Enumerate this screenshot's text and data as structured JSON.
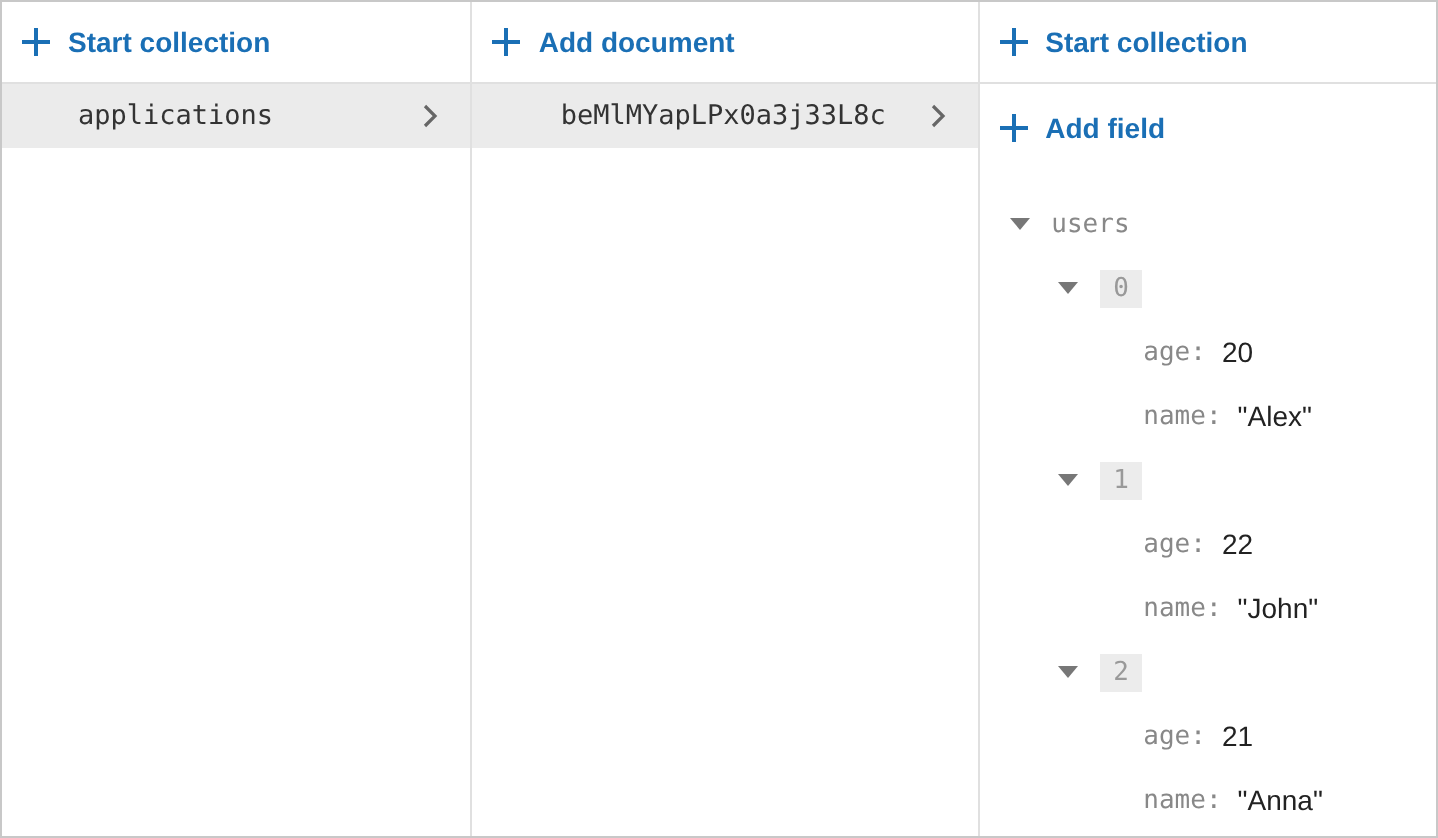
{
  "collections_panel": {
    "action": {
      "label": "Start collection"
    },
    "items": [
      {
        "label": "applications",
        "selected": true
      }
    ]
  },
  "documents_panel": {
    "action": {
      "label": "Add document"
    },
    "items": [
      {
        "label": "beMlMYapLPx0a3j33L8c",
        "selected": true
      }
    ]
  },
  "document_panel": {
    "actions": [
      {
        "label": "Start collection"
      },
      {
        "label": "Add field"
      }
    ],
    "fields": [
      {
        "key": "users",
        "expanded": true,
        "children": [
          {
            "key": "0",
            "expanded": true,
            "children": [
              {
                "key": "age:",
                "value": "20"
              },
              {
                "key": "name:",
                "value": "\"Alex\""
              }
            ]
          },
          {
            "key": "1",
            "expanded": true,
            "children": [
              {
                "key": "age:",
                "value": "22"
              },
              {
                "key": "name:",
                "value": "\"John\""
              }
            ]
          },
          {
            "key": "2",
            "expanded": true,
            "children": [
              {
                "key": "age:",
                "value": "21"
              },
              {
                "key": "name:",
                "value": "\"Anna\""
              }
            ]
          }
        ]
      }
    ]
  }
}
